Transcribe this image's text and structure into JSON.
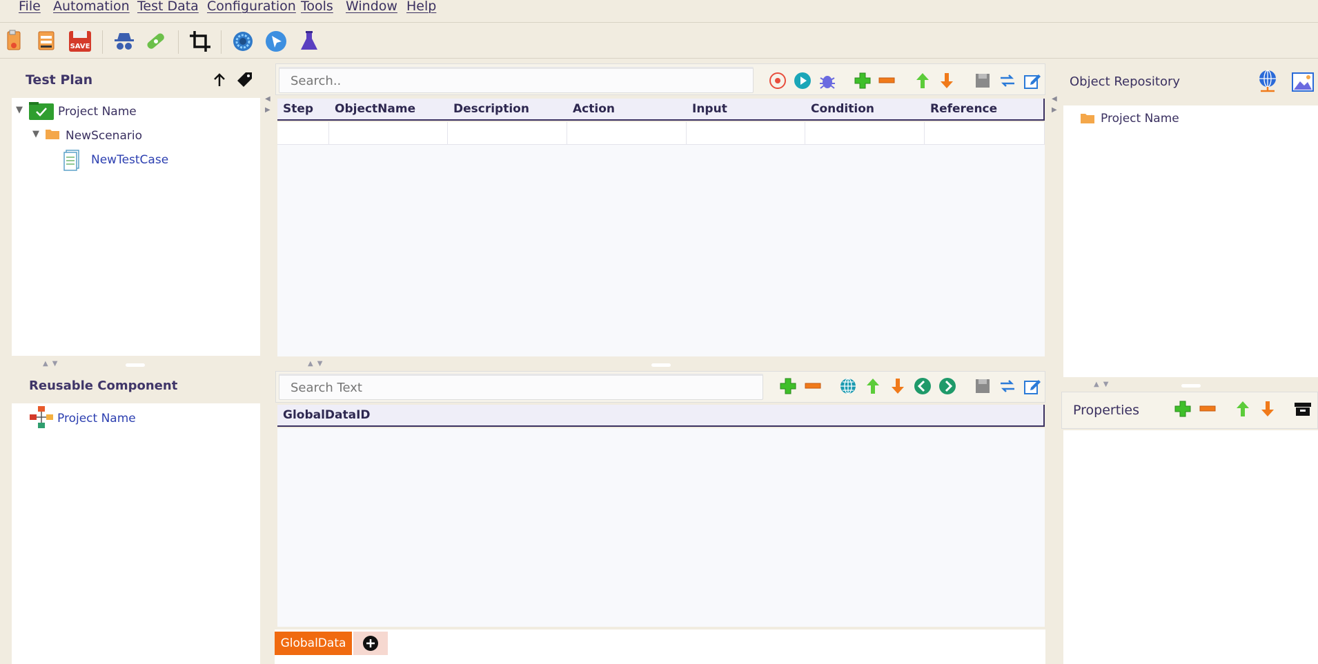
{
  "menu": [
    "File",
    "Automation",
    "Test Data",
    "Configuration",
    "Tools",
    "Window",
    "Help"
  ],
  "toolbar": {
    "icons": [
      "new-project-icon",
      "open-project-icon",
      "save-icon",
      "spy-icon",
      "heal-icon",
      "crop-icon",
      "settings-icon",
      "navigate-icon",
      "lab-flask-icon"
    ]
  },
  "test_plan": {
    "title": "Test Plan",
    "tree": {
      "project": "Project Name",
      "scenario": "NewScenario",
      "testcase": "NewTestCase"
    }
  },
  "reusable": {
    "title": "Reusable Component",
    "project": "Project Name"
  },
  "test_case_editor": {
    "search_placeholder": "Search..",
    "columns": [
      "Step",
      "ObjectName",
      "Description",
      "Action",
      "Input",
      "Condition",
      "Reference"
    ]
  },
  "test_data": {
    "search_placeholder": "Search Text",
    "columns": [
      "GlobalDataID"
    ],
    "tabs": [
      "GlobalData"
    ]
  },
  "object_repository": {
    "title": "Object Repository",
    "project": "Project Name"
  },
  "properties": {
    "title": "Properties"
  },
  "colors": {
    "background": "#f1ece0",
    "accent_orange": "#f06a10",
    "text": "#3a3060"
  }
}
